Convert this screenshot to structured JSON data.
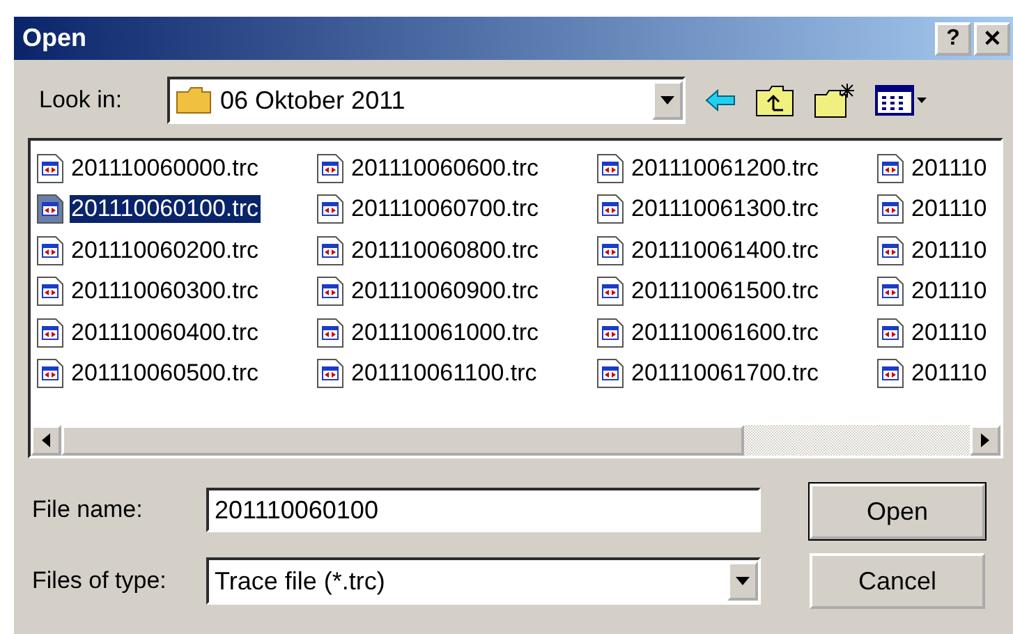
{
  "window": {
    "title": "Open",
    "buttons": [
      "?",
      "✕"
    ]
  },
  "look_in": {
    "label": "Look in:",
    "value": "06 Oktober 2011"
  },
  "files": [
    {
      "name": "201110060000.trc",
      "selected": false
    },
    {
      "name": "201110060100.trc",
      "selected": true
    },
    {
      "name": "201110060200.trc",
      "selected": false
    },
    {
      "name": "201110060300.trc",
      "selected": false
    },
    {
      "name": "201110060400.trc",
      "selected": false
    },
    {
      "name": "201110060500.trc",
      "selected": false
    },
    {
      "name": "201110060600.trc",
      "selected": false
    },
    {
      "name": "201110060700.trc",
      "selected": false
    },
    {
      "name": "201110060800.trc",
      "selected": false
    },
    {
      "name": "201110060900.trc",
      "selected": false
    },
    {
      "name": "201110061000.trc",
      "selected": false
    },
    {
      "name": "201110061100.trc",
      "selected": false
    },
    {
      "name": "201110061200.trc",
      "selected": false
    },
    {
      "name": "201110061300.trc",
      "selected": false
    },
    {
      "name": "201110061400.trc",
      "selected": false
    },
    {
      "name": "201110061500.trc",
      "selected": false
    },
    {
      "name": "201110061600.trc",
      "selected": false
    },
    {
      "name": "201110061700.trc",
      "selected": false
    },
    {
      "name": "201110",
      "selected": false
    },
    {
      "name": "201110",
      "selected": false
    },
    {
      "name": "201110",
      "selected": false
    },
    {
      "name": "201110",
      "selected": false
    },
    {
      "name": "201110",
      "selected": false
    },
    {
      "name": "201110",
      "selected": false
    }
  ],
  "file_name": {
    "label": "File name:",
    "value": "201110060100"
  },
  "file_type": {
    "label": "Files of type:",
    "value": "Trace file (*.trc)"
  },
  "buttons": [
    "Open",
    "Cancel"
  ]
}
